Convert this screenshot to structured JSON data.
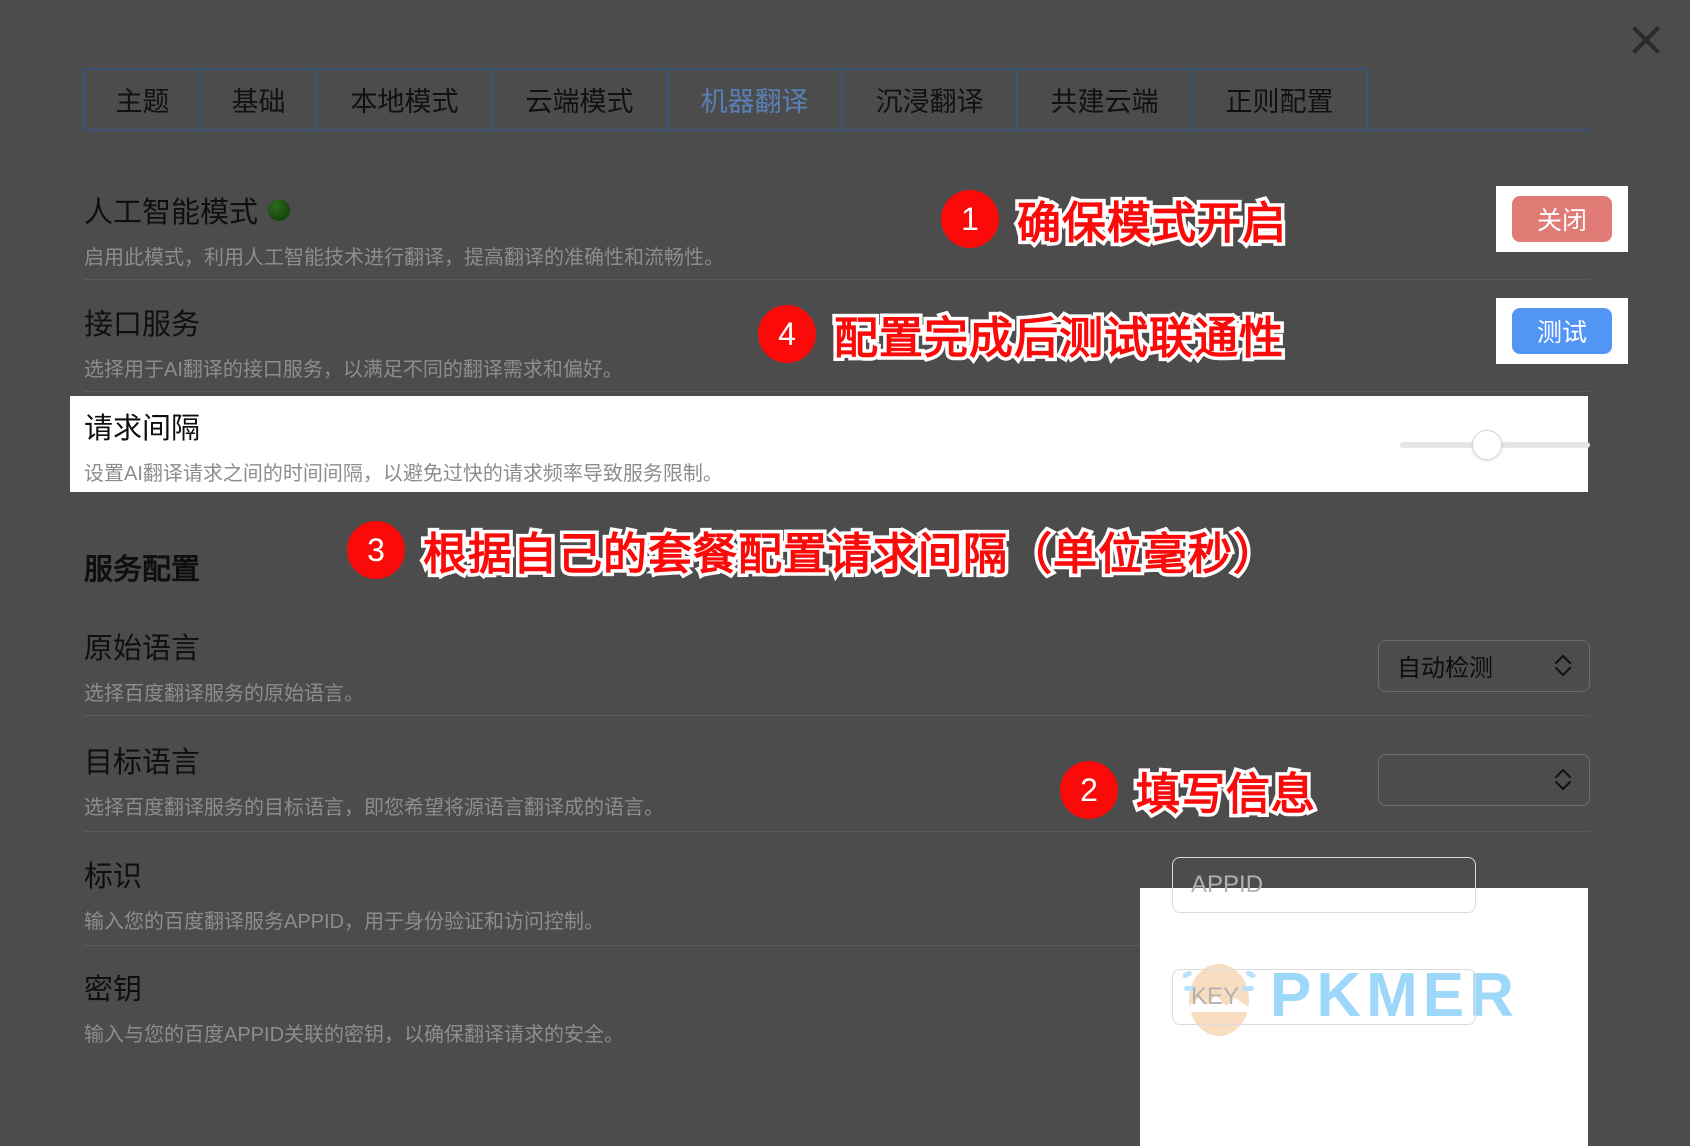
{
  "window": {
    "close_icon": "close-icon",
    "background_color": "#4c4c4c"
  },
  "tabs": [
    {
      "label": "主题",
      "active": false
    },
    {
      "label": "基础",
      "active": false
    },
    {
      "label": "本地模式",
      "active": false
    },
    {
      "label": "云端模式",
      "active": false
    },
    {
      "label": "机器翻译",
      "active": true
    },
    {
      "label": "沉浸翻译",
      "active": false
    },
    {
      "label": "共建云端",
      "active": false
    },
    {
      "label": "正则配置",
      "active": false
    }
  ],
  "settings": {
    "ai_mode": {
      "title": "人工智能模式",
      "status_dot": "green-status-dot",
      "desc": "启用此模式，利用人工智能技术进行翻译，提高翻译的准确性和流畅性。",
      "button_label": "关闭",
      "button_color": "#e07b75"
    },
    "api_service": {
      "title": "接口服务",
      "desc": "选择用于AI翻译的接口服务，以满足不同的翻译需求和偏好。",
      "button_label": "测试",
      "button_color": "#5295f5"
    },
    "request_interval": {
      "title": "请求间隔",
      "desc": "设置AI翻译请求之间的时间间隔，以避免过快的请求频率导致服务限制。",
      "slider_value": 45
    }
  },
  "service_config": {
    "heading": "服务配置",
    "source_language": {
      "title": "原始语言",
      "desc": "选择百度翻译服务的原始语言。",
      "selected": "自动检测"
    },
    "target_language": {
      "title": "目标语言",
      "desc": "选择百度翻译服务的目标语言，即您希望将源语言翻译成的语言。",
      "selected": ""
    },
    "appid": {
      "title": "标识",
      "desc": "输入您的百度翻译服务APPID，用于身份验证和访问控制。",
      "placeholder": "APPID",
      "value": ""
    },
    "secret_key": {
      "title": "密钥",
      "desc": "输入与您的百度APPID关联的密钥，以确保翻译请求的安全。",
      "placeholder": "KEY",
      "value": ""
    }
  },
  "annotations": [
    {
      "number": "1",
      "text": "确保模式开启"
    },
    {
      "number": "4",
      "text": "配置完成后测试联通性"
    },
    {
      "number": "3",
      "text": "根据自己的套餐配置请求间隔（单位毫秒）"
    },
    {
      "number": "2",
      "text": "填写信息"
    }
  ],
  "watermark": {
    "text": "PKMER",
    "icon": "egg-logo-icon",
    "color": "#62c0f7"
  }
}
